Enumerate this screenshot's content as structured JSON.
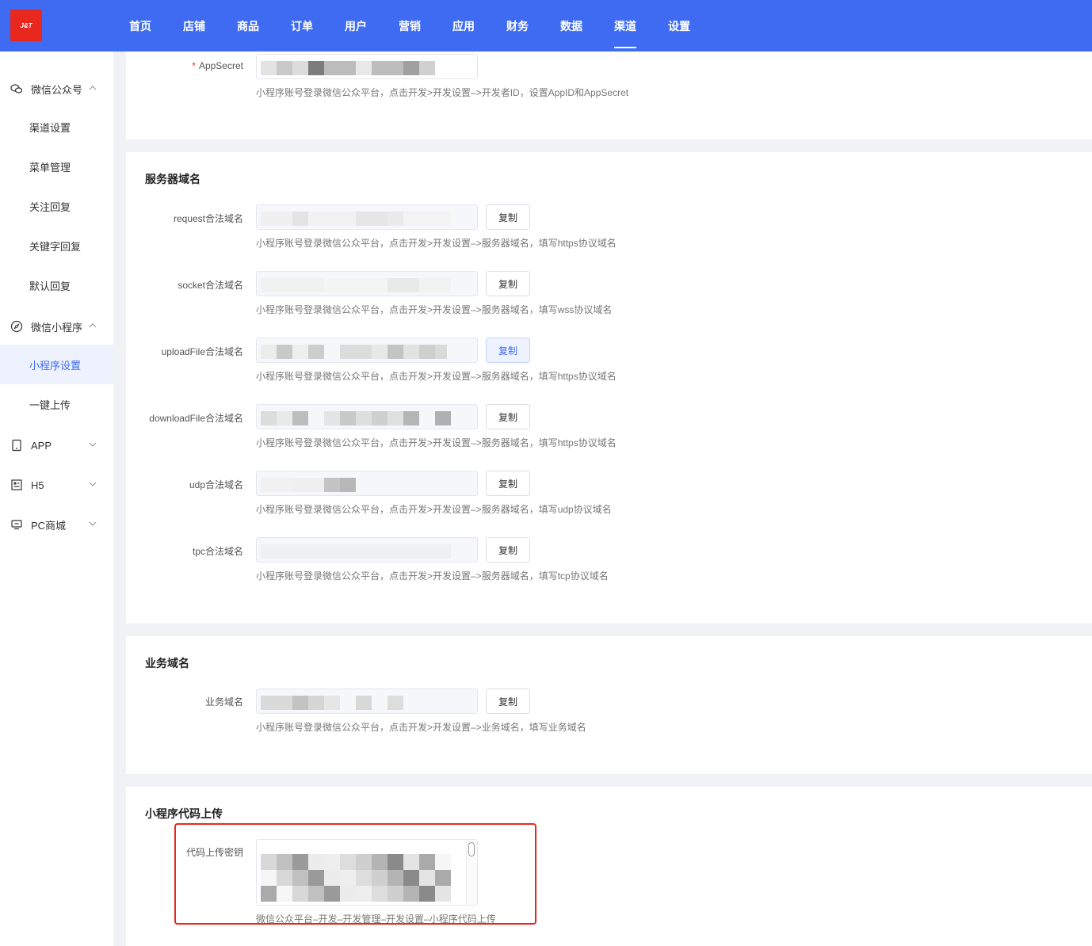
{
  "brand": {
    "logo_text": "J&T"
  },
  "nav": {
    "items": [
      "首页",
      "店铺",
      "商品",
      "订单",
      "用户",
      "营销",
      "应用",
      "财务",
      "数据",
      "渠道",
      "设置"
    ],
    "active_index": 9
  },
  "sidebar": {
    "wechat_official": {
      "label": "微信公众号",
      "icon": "wechat-icon",
      "expanded": true
    },
    "wechat_official_items": [
      "渠道设置",
      "菜单管理",
      "关注回复",
      "关键字回复",
      "默认回复"
    ],
    "mini_program": {
      "label": "微信小程序",
      "icon": "compass-icon",
      "expanded": true
    },
    "mini_program_items": [
      "小程序设置",
      "一键上传"
    ],
    "mini_program_active": 0,
    "app": {
      "label": "APP",
      "icon": "tablet-icon"
    },
    "h5": {
      "label": "H5",
      "icon": "h5-icon"
    },
    "pc": {
      "label": "PC商城",
      "icon": "monitor-icon"
    }
  },
  "appsecret": {
    "label": "AppSecret",
    "required_mark": "*",
    "hint": "小程序账号登录微信公众平台，点击开发>开发设置–>开发者ID，设置AppID和AppSecret"
  },
  "server_domains": {
    "title": "服务器域名",
    "copy_label": "复制",
    "rows": [
      {
        "label": "request合法域名",
        "hint": "小程序账号登录微信公众平台，点击开发>开发设置–>服务器域名，填写https协议域名"
      },
      {
        "label": "socket合法域名",
        "hint": "小程序账号登录微信公众平台，点击开发>开发设置–>服务器域名，填写wss协议域名"
      },
      {
        "label": "uploadFile合法域名",
        "hint": "小程序账号登录微信公众平台，点击开发>开发设置–>服务器域名，填写https协议域名"
      },
      {
        "label": "downloadFile合法域名",
        "hint": "小程序账号登录微信公众平台，点击开发>开发设置–>服务器域名，填写https协议域名"
      },
      {
        "label": "udp合法域名",
        "hint": "小程序账号登录微信公众平台，点击开发>开发设置–>服务器域名，填写udp协议域名"
      },
      {
        "label": "tpc合法域名",
        "hint": "小程序账号登录微信公众平台，点击开发>开发设置–>服务器域名，填写tcp协议域名"
      }
    ]
  },
  "business_domain": {
    "title": "业务域名",
    "label": "业务域名",
    "copy_label": "复制",
    "hint": "小程序账号登录微信公众平台，点击开发>开发设置–>业务域名，填写业务域名"
  },
  "code_upload": {
    "title": "小程序代码上传",
    "label": "代码上传密钥",
    "hint": "微信公众平台–开发–开发管理–开发设置–小程序代码上传"
  },
  "colors": {
    "primary": "#3e6bf1",
    "highlight": "#e8281f"
  }
}
